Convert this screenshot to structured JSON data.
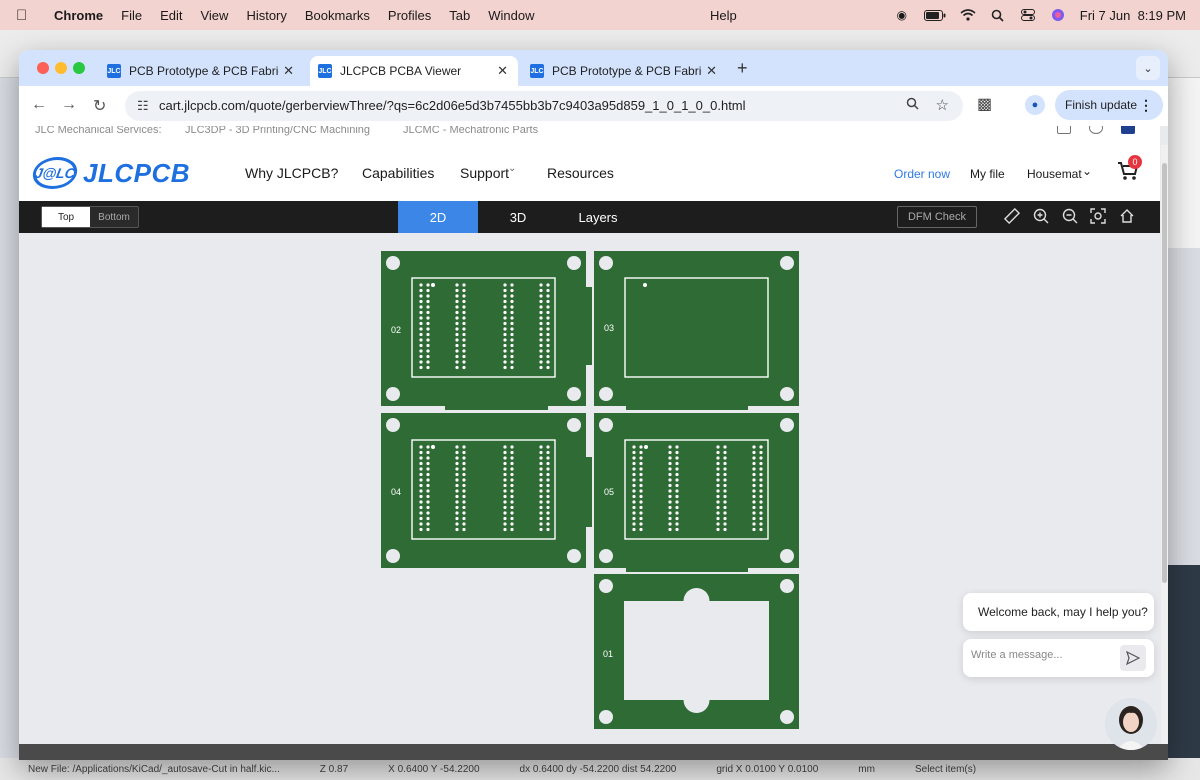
{
  "menubar": {
    "app": "Chrome",
    "items": [
      "File",
      "Edit",
      "View",
      "History",
      "Bookmarks",
      "Profiles",
      "Tab",
      "Window"
    ],
    "help": "Help",
    "datetime": "Fri 7 Jun  8:19 PM"
  },
  "background_app": {
    "status_left": "New File: /Applications/KiCad/_autosave-Cut in half.kic...",
    "status_items": [
      "Z 0.87",
      "X 0.6400  Y -54.2200",
      "dx 0.6400  dy -54.2200  dist 54.2200",
      "grid X 0.0100  Y 0.0100",
      "mm",
      "Select item(s)"
    ]
  },
  "browser": {
    "tabs": [
      {
        "title": "PCB Prototype & PCB Fabrica",
        "favicon": "JLC",
        "active": false
      },
      {
        "title": "JLCPCB PCBA Viewer",
        "favicon": "JLC",
        "active": true
      },
      {
        "title": "PCB Prototype & PCB Fabrica",
        "favicon": "JLC",
        "active": false
      }
    ],
    "url": "cart.jlcpcb.com/quote/gerberviewThree/?qs=6c2d06e5d3b7455bb3b7c9403a95d859_1_0_1_0_0.html",
    "finish_update": "Finish update"
  },
  "site": {
    "subnav": {
      "label": "JLC Mechanical Services:",
      "link1": "JLC3DP - 3D Printing/CNC Machining",
      "link2": "JLCMC - Mechatronic Parts"
    },
    "logo_badge": "J@LC",
    "logo_word": "JLCPCB",
    "nav": [
      "Why JLCPCB?",
      "Capabilities",
      "Support",
      "Resources"
    ],
    "support_caret": "⌄",
    "order_now": "Order now",
    "my_file": "My file",
    "user": "Housemat",
    "cart_count": "0"
  },
  "viewer": {
    "side_toggle": [
      "Top",
      "Bottom"
    ],
    "view_tabs": [
      "2D",
      "3D",
      "Layers"
    ],
    "active_view": "2D",
    "dfm_check": "DFM Check",
    "tools": [
      "ruler-icon",
      "zoom-in-icon",
      "zoom-out-icon",
      "fit-icon",
      "home-icon"
    ]
  },
  "boards": [
    {
      "label": "02",
      "type": "connectors"
    },
    {
      "label": "03",
      "type": "outline"
    },
    {
      "label": "04",
      "type": "connectors"
    },
    {
      "label": "05",
      "type": "connectors"
    },
    {
      "label": "01",
      "type": "cutout"
    }
  ],
  "colors": {
    "pcb": "#2e6b35",
    "accent": "#3b86e6",
    "brand": "#1e6fdf"
  },
  "chat": {
    "welcome": "Welcome back, may I help you?",
    "placeholder": "Write a message..."
  }
}
